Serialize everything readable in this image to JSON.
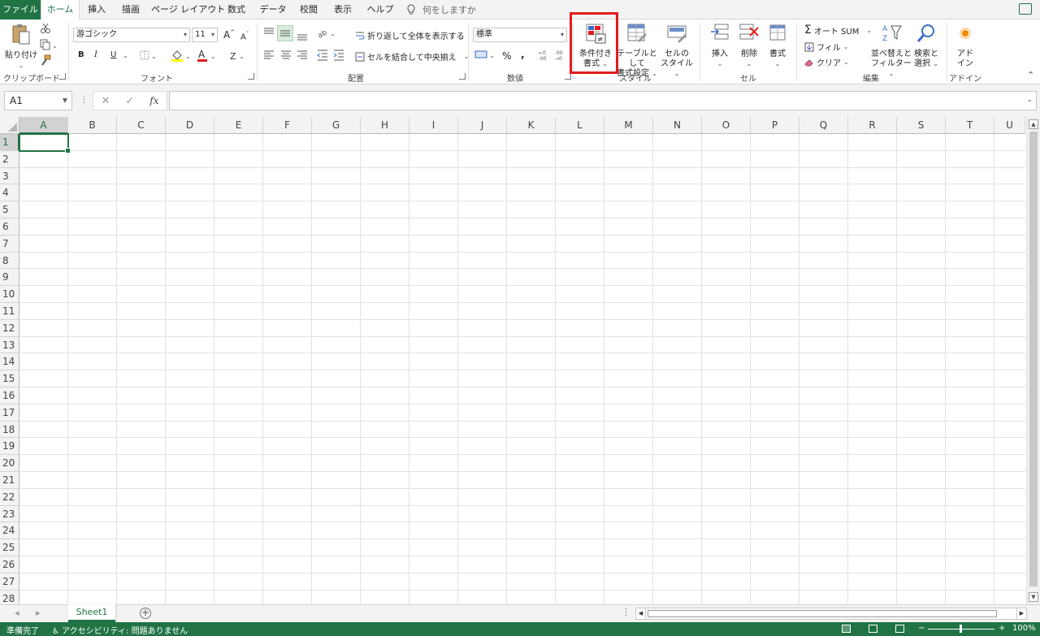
{
  "tabs": {
    "file": "ファイル",
    "home": "ホーム",
    "insert": "挿入",
    "draw": "描画",
    "page_layout": "ページ レイアウト",
    "formulas": "数式",
    "data": "データ",
    "review": "校閲",
    "view": "表示",
    "help": "ヘルプ",
    "tell_me": "何をしますか"
  },
  "ribbon": {
    "clipboard": {
      "paste": "貼り付け",
      "label": "クリップボード"
    },
    "font": {
      "name": "游ゴシック",
      "size": "11",
      "bold": "B",
      "italic": "I",
      "underline": "U",
      "label": "フォント"
    },
    "alignment": {
      "wrap_text": "折り返して全体を表示する",
      "merge_center": "セルを結合して中央揃え",
      "label": "配置"
    },
    "number": {
      "format": "標準",
      "percent": "%",
      "comma": ",",
      "label": "数値"
    },
    "styles": {
      "conditional_formatting_l1": "条件付き",
      "conditional_formatting_l2": "書式",
      "format_as_table_l1": "テーブルとして",
      "format_as_table_l2": "書式設定",
      "cell_styles_l1": "セルの",
      "cell_styles_l2": "スタイル",
      "label": "スタイル"
    },
    "cells": {
      "insert": "挿入",
      "delete": "削除",
      "format": "書式",
      "label": "セル"
    },
    "editing": {
      "autosum": "オート SUM",
      "fill": "フィル",
      "clear": "クリア",
      "sort_filter_l1": "並べ替えと",
      "sort_filter_l2": "フィルター",
      "find_select_l1": "検索と",
      "find_select_l2": "選択",
      "label": "編集"
    },
    "addins": {
      "addins_l1": "アド",
      "addins_l2": "イン",
      "label": "アドイン"
    }
  },
  "formula_bar": {
    "name_box": "A1",
    "cancel": "✕",
    "enter": "✓",
    "fx": "fx",
    "value": ""
  },
  "grid": {
    "columns": [
      "A",
      "B",
      "C",
      "D",
      "E",
      "F",
      "G",
      "H",
      "I",
      "J",
      "K",
      "L",
      "M",
      "N",
      "O",
      "P",
      "Q",
      "R",
      "S",
      "T",
      "U"
    ],
    "rows": [
      "1",
      "2",
      "3",
      "4",
      "5",
      "6",
      "7",
      "8",
      "9",
      "10",
      "11",
      "12",
      "13",
      "14",
      "15",
      "16",
      "17",
      "18",
      "19",
      "20",
      "21",
      "22",
      "23",
      "24",
      "25",
      "26",
      "27",
      "28"
    ],
    "active_cell": "A1"
  },
  "sheets": {
    "tabs": [
      "Sheet1"
    ],
    "add": "+"
  },
  "status": {
    "ready": "準備完了",
    "accessibility": "アクセシビリティ: 問題ありません",
    "zoom": "100%",
    "zoom_minus": "−",
    "zoom_plus": "+"
  },
  "colors": {
    "accent": "#217346",
    "highlight": "#e21c1c"
  }
}
